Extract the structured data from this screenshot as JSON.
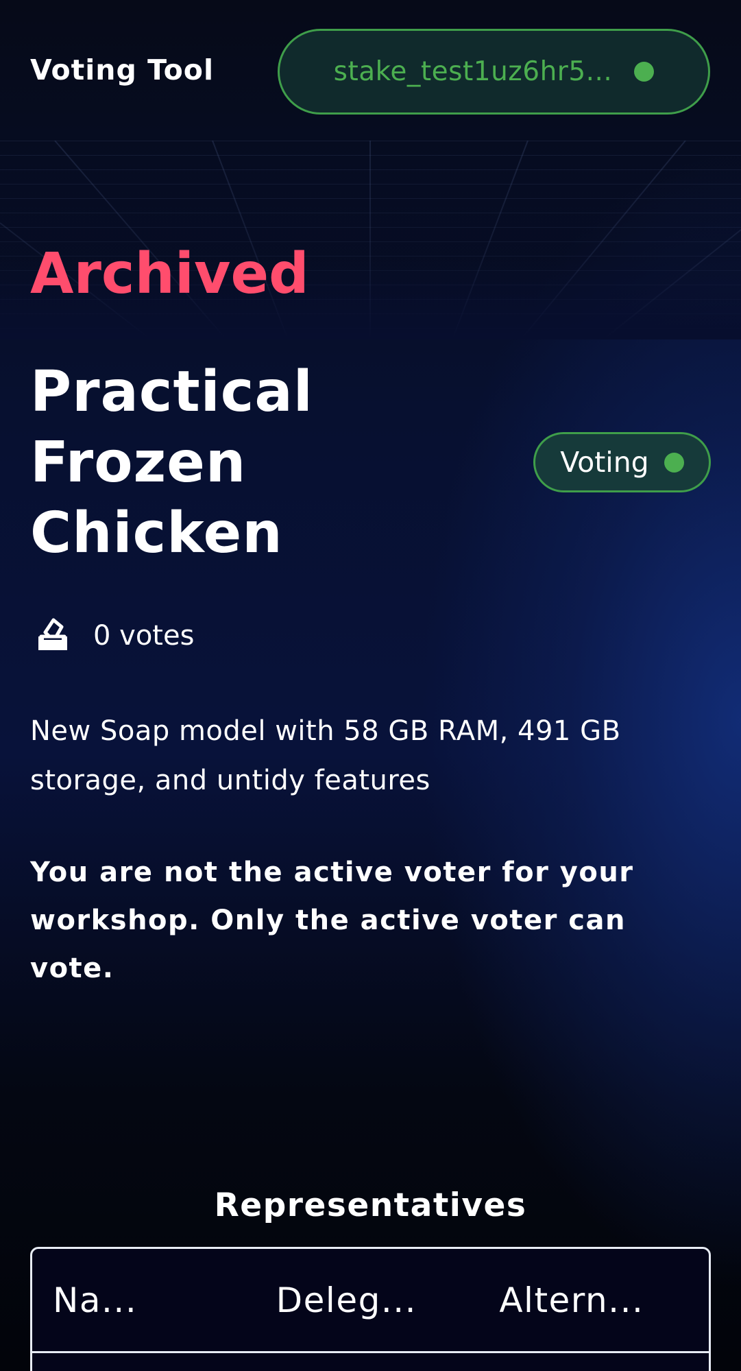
{
  "header": {
    "brand": "Voting Tool",
    "wallet_address": "stake_test1uz6hr5..."
  },
  "proposal": {
    "status": "Archived",
    "title": "Practical Frozen Chicken",
    "badge_label": "Voting",
    "votes": "0 votes",
    "description": "New Soap model with 58 GB RAM, 491 GB storage, and untidy features",
    "notice": "You are not the active voter for your workshop. Only the active voter can vote."
  },
  "representatives": {
    "heading": "Representatives",
    "columns": [
      "Na...",
      "Deleg...",
      "Altern..."
    ]
  },
  "colors": {
    "status_archived": "#ff4d6d",
    "connected_green": "#4caf50",
    "background": "#050814"
  },
  "icons": {
    "votes": "ballot-box-icon",
    "status": "status-dot-icon"
  }
}
